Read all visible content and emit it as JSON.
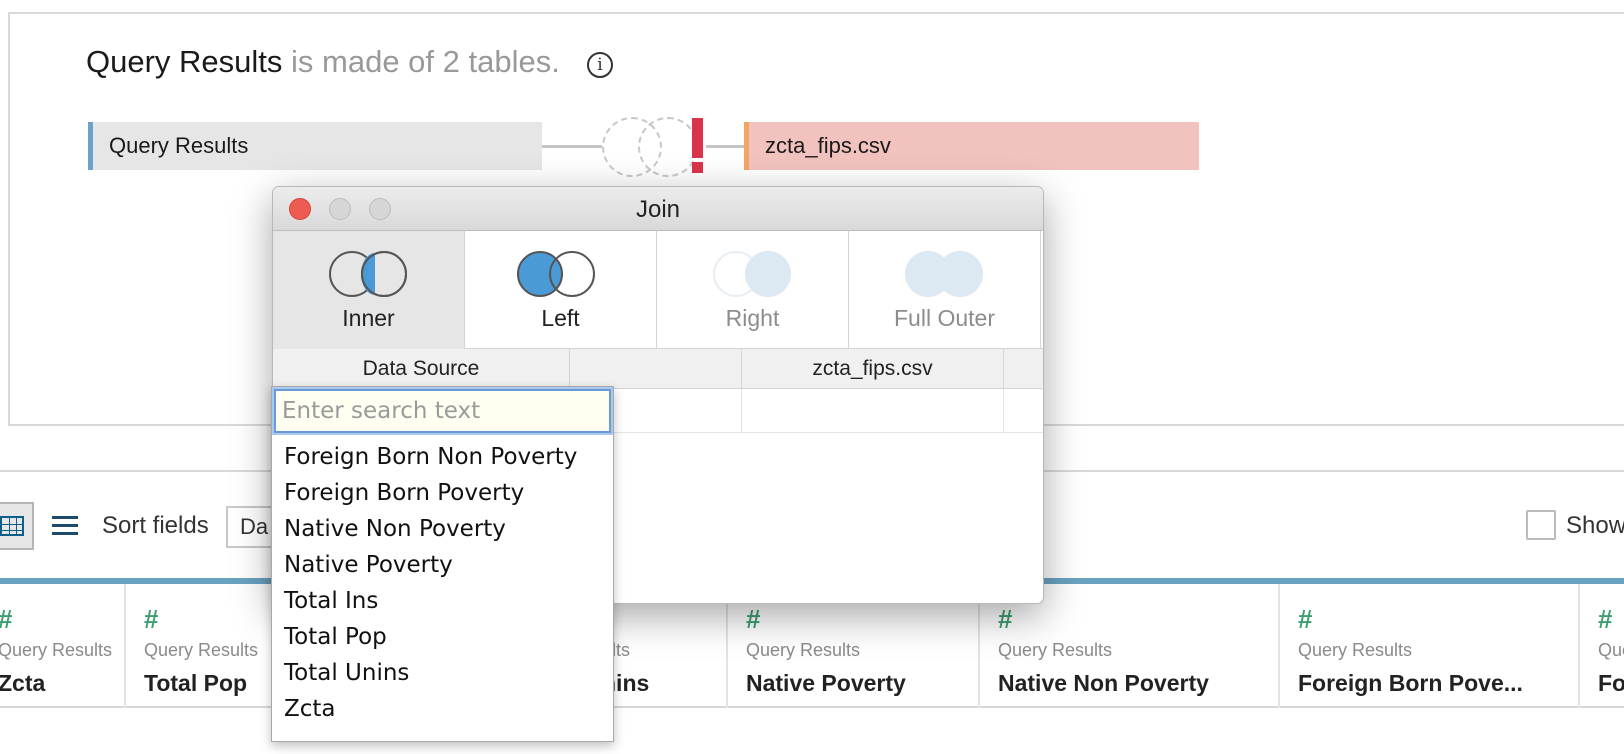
{
  "canvas": {
    "title_main": "Query Results",
    "title_sub": " is made of 2 tables.",
    "info_icon": "info-icon",
    "left_table": "Query Results",
    "right_table": "zcta_fips.csv"
  },
  "toolbar": {
    "sort_label": "Sort fields",
    "sort_value": "Da",
    "show_label": "Show"
  },
  "columns": [
    {
      "src": "Query Results",
      "name": "Zcta"
    },
    {
      "src": "Query Results",
      "name": "Total Pop"
    },
    {
      "src": "ults",
      "name": "nins"
    },
    {
      "src": "Query Results",
      "name": "Native Poverty"
    },
    {
      "src": "Query Results",
      "name": "Native Non Poverty"
    },
    {
      "src": "Query Results",
      "name": "Foreign Born Pove..."
    },
    {
      "src": "Que",
      "name": "Fo"
    }
  ],
  "dialog": {
    "title": "Join",
    "join_types": [
      {
        "label": "Inner",
        "selected": true
      },
      {
        "label": "Left",
        "selected": false
      },
      {
        "label": "Right",
        "selected": false
      },
      {
        "label": "Full Outer",
        "selected": false
      }
    ],
    "cond_headers": {
      "left": "Data Source",
      "right": "zcta_fips.csv"
    }
  },
  "dropdown": {
    "placeholder": "Enter search text",
    "options": [
      "Foreign Born Non Poverty",
      "Foreign Born Poverty",
      "Native Non Poverty",
      "Native Poverty",
      "Total Ins",
      "Total Pop",
      "Total Unins",
      "Zcta"
    ]
  },
  "colors": {
    "accent_blue": "#4a9ad5",
    "error_red": "#d9344b",
    "field_type_green": "#3d9e6f"
  }
}
